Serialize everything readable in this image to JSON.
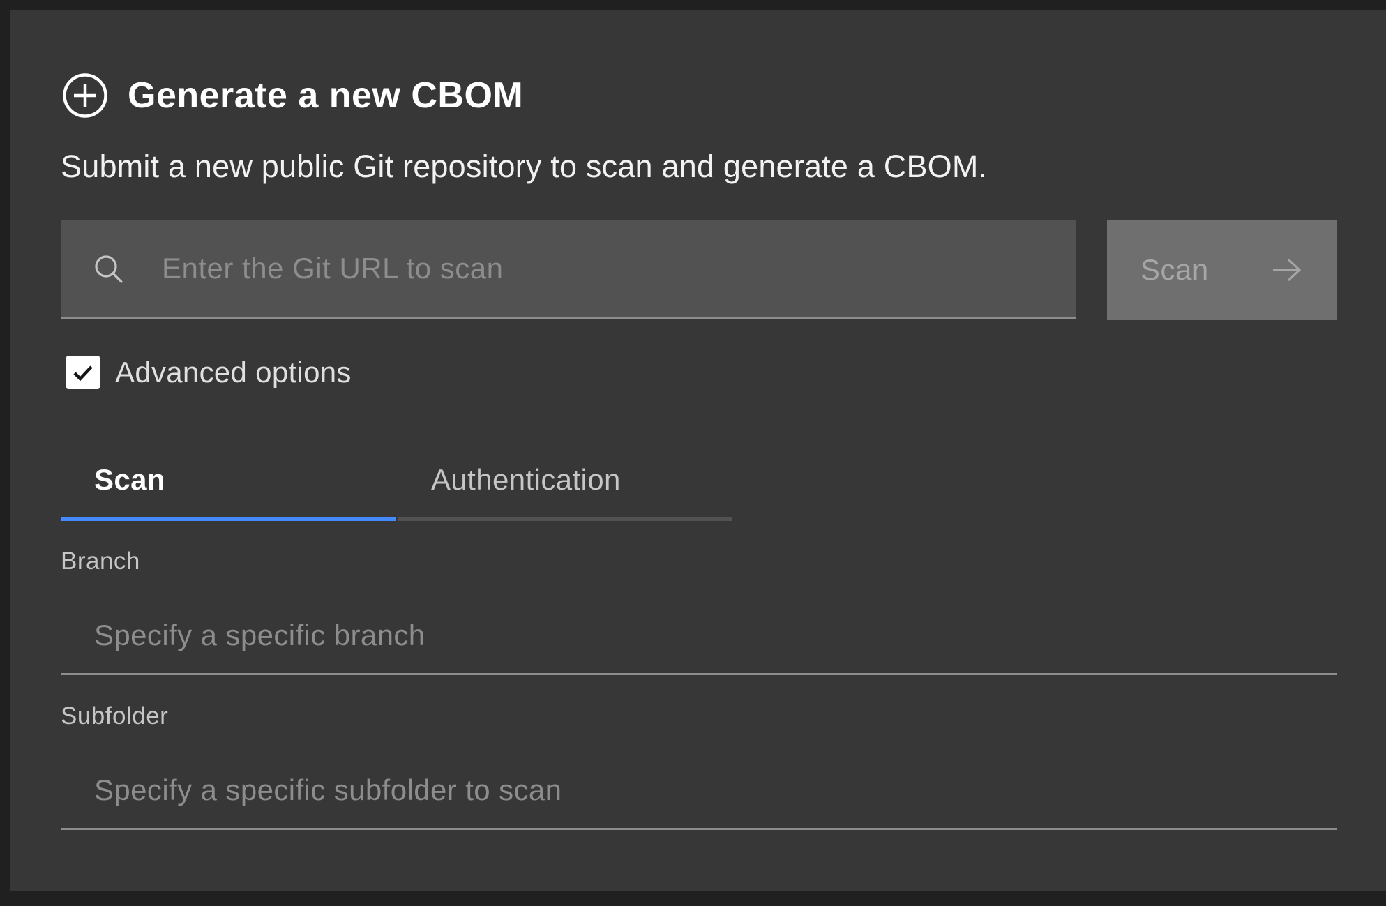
{
  "header": {
    "icon": "plus-circle-icon",
    "title": "Generate a new CBOM",
    "subtitle": "Submit a new public Git repository to scan and generate a CBOM."
  },
  "search": {
    "icon": "search-icon",
    "placeholder": "Enter the Git URL to scan",
    "value": ""
  },
  "scan_button": {
    "label": "Scan",
    "icon": "arrow-right-icon",
    "disabled": true
  },
  "advanced": {
    "label": "Advanced options",
    "checked": true
  },
  "tabs": [
    {
      "label": "Scan",
      "active": true
    },
    {
      "label": "Authentication",
      "active": false
    }
  ],
  "fields": {
    "branch": {
      "label": "Branch",
      "placeholder": "Specify a specific branch",
      "value": ""
    },
    "subfolder": {
      "label": "Subfolder",
      "placeholder": "Specify a specific subfolder to scan",
      "value": ""
    }
  },
  "colors": {
    "accent": "#4589ff",
    "panel_bg": "#373737",
    "field_bg": "#525252"
  }
}
